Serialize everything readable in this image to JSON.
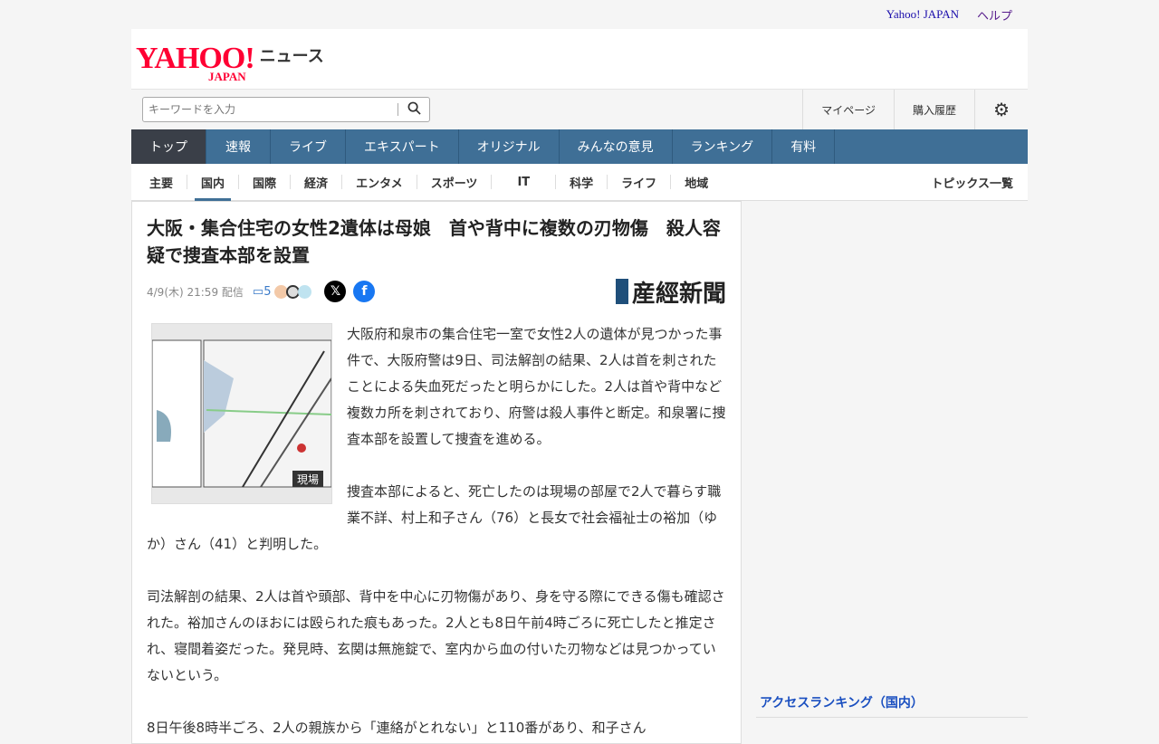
{
  "topbar": {
    "yahoo_japan": "Yahoo! JAPAN",
    "help": "ヘルプ"
  },
  "brand": {
    "logo": "YAHOO!",
    "logo_sub": "JAPAN",
    "service": "ニュース"
  },
  "search": {
    "placeholder": "キーワードを入力"
  },
  "header_links": [
    "マイページ",
    "購入履歴"
  ],
  "nav": [
    "トップ",
    "速報",
    "ライブ",
    "エキスパート",
    "オリジナル",
    "みんなの意見",
    "ランキング",
    "有料"
  ],
  "subnav": [
    "主要",
    "国内",
    "国際",
    "経済",
    "エンタメ",
    "スポーツ",
    "IT",
    "科学",
    "ライフ",
    "地域"
  ],
  "subnav_all": "トピックス一覧",
  "article": {
    "title": "大阪・集合住宅の女性2遺体は母娘　首や背中に複数の刃物傷　殺人容疑で捜査本部を設置",
    "date": "4/9(木) 21:59 配信",
    "comments": "5",
    "publisher": "産經新聞",
    "map_labels": {
      "tag": "現場"
    },
    "paragraphs": [
      "大阪府和泉市の集合住宅一室で女性2人の遺体が見つかった事件で、大阪府警は9日、司法解剖の結果、2人は首を刺されたことによる失血死だったと明らかにした。2人は首や背中など複数カ所を刺されており、府警は殺人事件と断定。和泉署に捜査本部を設置して捜査を進める。",
      "捜査本部によると、死亡したのは現場の部屋で2人で暮らす職業不詳、村上和子さん（76）と長女で社会福祉士の裕加（ゆか）さん（41）と判明した。",
      "司法解剖の結果、2人は首や頭部、背中を中心に刃物傷があり、身を守る際にできる傷も確認された。裕加さんのほおには殴られた痕もあった。2人とも8日午前4時ごろに死亡したと推定され、寝間着姿だった。発見時、玄関は無施錠で、室内から血の付いた刃物などは見つかっていないという。",
      "8日午後8時半ごろ、2人の親族から「連絡がとれない」と110番があり、和子さん"
    ]
  },
  "sidebar": {
    "ranking_title": "アクセスランキング（国内）"
  }
}
